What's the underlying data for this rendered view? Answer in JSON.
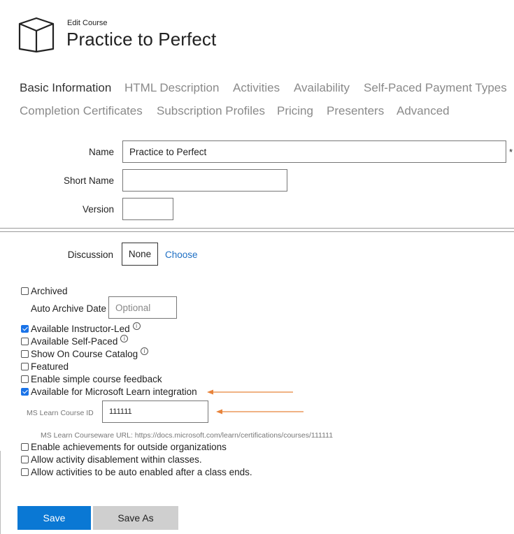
{
  "header": {
    "subtitle": "Edit Course",
    "title": "Practice to Perfect"
  },
  "tabs": [
    {
      "label": "Basic Information",
      "active": true
    },
    {
      "label": "HTML Description"
    },
    {
      "label": "Activities"
    },
    {
      "label": "Availability"
    },
    {
      "label": "Self-Paced Payment Types"
    },
    {
      "label": "Completion Certificates"
    },
    {
      "label": "Subscription Profiles"
    },
    {
      "label": "Pricing"
    },
    {
      "label": "Presenters"
    },
    {
      "label": "Advanced"
    }
  ],
  "form": {
    "name_label": "Name",
    "name_value": "Practice to Perfect",
    "required_mark": "*",
    "short_name_label": "Short Name",
    "short_name_value": "",
    "version_label": "Version",
    "version_value": "",
    "discussion_label": "Discussion",
    "discussion_value": "None",
    "choose_link": "Choose",
    "archived_label": "Archived",
    "auto_archive_label": "Auto Archive Date",
    "auto_archive_placeholder": "Optional",
    "options": [
      {
        "label": "Available Instructor-Led",
        "checked": true,
        "info": true
      },
      {
        "label": "Available Self-Paced",
        "checked": false,
        "info": true
      },
      {
        "label": "Show On Course Catalog",
        "checked": false,
        "info": true
      },
      {
        "label": "Featured",
        "checked": false
      },
      {
        "label": "Enable simple course feedback",
        "checked": false
      },
      {
        "label": "Available for Microsoft Learn integration",
        "checked": true
      }
    ],
    "ms_learn_id_label": "MS Learn Course ID",
    "ms_learn_id_value": "111111",
    "ms_learn_url_text": "MS Learn Courseware URL: https://docs.microsoft.com/learn/certifications/courses/111111",
    "extra_options": [
      {
        "label": "Enable achievements for outside organizations",
        "checked": false
      },
      {
        "label": "Allow activity disablement within classes.",
        "checked": false
      },
      {
        "label": "Allow activities to be auto enabled after a class ends.",
        "checked": false
      }
    ]
  },
  "buttons": {
    "save": "Save",
    "save_as": "Save As"
  },
  "colors": {
    "primary_button": "#0a78d4",
    "secondary_button": "#cfcfcf",
    "link": "#1e6fc4",
    "annotation_arrow": "#e8833a",
    "checkbox_checked": "#1a73e8"
  }
}
